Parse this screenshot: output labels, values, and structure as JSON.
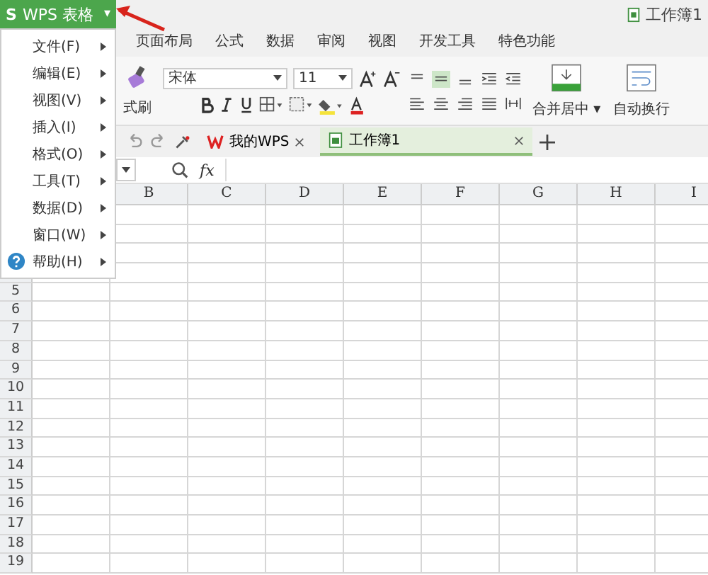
{
  "app_button": {
    "logo": "S",
    "label": "WPS 表格",
    "caret": "▾"
  },
  "title": "工作簿1",
  "ribbon_tabs": [
    {
      "label": "页面布局",
      "selected": false
    },
    {
      "label": "公式",
      "selected": false
    },
    {
      "label": "数据",
      "selected": false
    },
    {
      "label": "审阅",
      "selected": false
    },
    {
      "label": "视图",
      "selected": false
    },
    {
      "label": "开发工具",
      "selected": false
    },
    {
      "label": "特色功能",
      "selected": false
    }
  ],
  "ribbon": {
    "format_painter": "式刷",
    "font": "宋体",
    "size": "11",
    "merge": "合并居中",
    "merge_caret": "▾",
    "wrap": "自动换行"
  },
  "doc_tabs": [
    {
      "label": "我的WPS",
      "selected": false,
      "kind": "home"
    },
    {
      "label": "工作簿1",
      "selected": true,
      "kind": "sheet"
    }
  ],
  "formula_bar": {
    "fx": "fx"
  },
  "columns": [
    "B",
    "C",
    "D",
    "E",
    "F",
    "G",
    "H",
    "I"
  ],
  "rows": [
    "5",
    "6",
    "7",
    "8",
    "9",
    "10",
    "11",
    "12",
    "13",
    "14",
    "15",
    "16",
    "17",
    "18",
    "19"
  ],
  "menu": [
    {
      "label": "文件(F)",
      "kind": "plain"
    },
    {
      "label": "编辑(E)",
      "kind": "plain"
    },
    {
      "label": "视图(V)",
      "kind": "plain"
    },
    {
      "label": "插入(I)",
      "kind": "plain"
    },
    {
      "label": "格式(O)",
      "kind": "plain"
    },
    {
      "label": "工具(T)",
      "kind": "plain"
    },
    {
      "label": "数据(D)",
      "kind": "plain"
    },
    {
      "label": "窗口(W)",
      "kind": "plain"
    },
    {
      "label": "帮助(H)",
      "kind": "help"
    }
  ]
}
